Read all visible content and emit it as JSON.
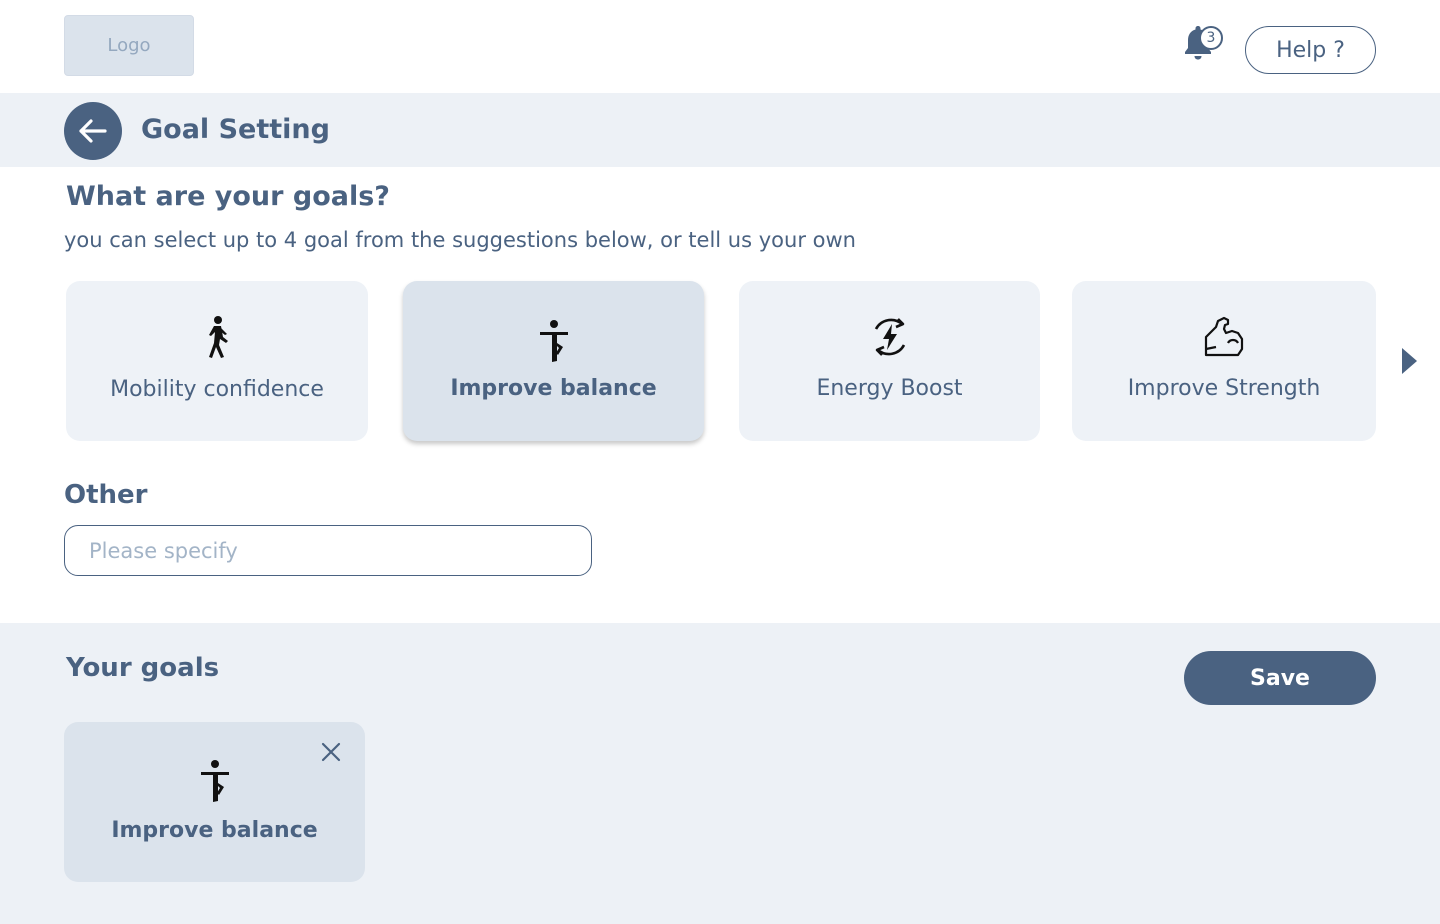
{
  "header": {
    "logo": "Logo",
    "notifications_count": "3",
    "help_label": "Help ?"
  },
  "titlebar": {
    "title": "Goal Setting",
    "back_icon": "arrow-left-icon"
  },
  "question": {
    "heading": "What are your goals?",
    "subtitle": "you can select up to 4 goal from the suggestions below, or tell us your own"
  },
  "goal_options": [
    {
      "label": "Mobility confidence",
      "icon": "walking-person-icon",
      "selected": false
    },
    {
      "label": "Improve balance",
      "icon": "balancing-person-icon",
      "selected": true
    },
    {
      "label": "Energy Boost",
      "icon": "energy-bolt-icon",
      "selected": false
    },
    {
      "label": "Improve Strength",
      "icon": "flexed-arm-icon",
      "selected": false
    }
  ],
  "other": {
    "label": "Other",
    "placeholder": "Please specify",
    "value": ""
  },
  "your_goals": {
    "heading": "Your goals",
    "save_label": "Save",
    "items": [
      {
        "label": "Improve balance",
        "icon": "balancing-person-icon"
      }
    ]
  },
  "colors": {
    "accent": "#4a6281",
    "card_bg": "#eef2f7",
    "card_selected_bg": "#dbe3ec",
    "band_bg": "#edf1f6"
  }
}
